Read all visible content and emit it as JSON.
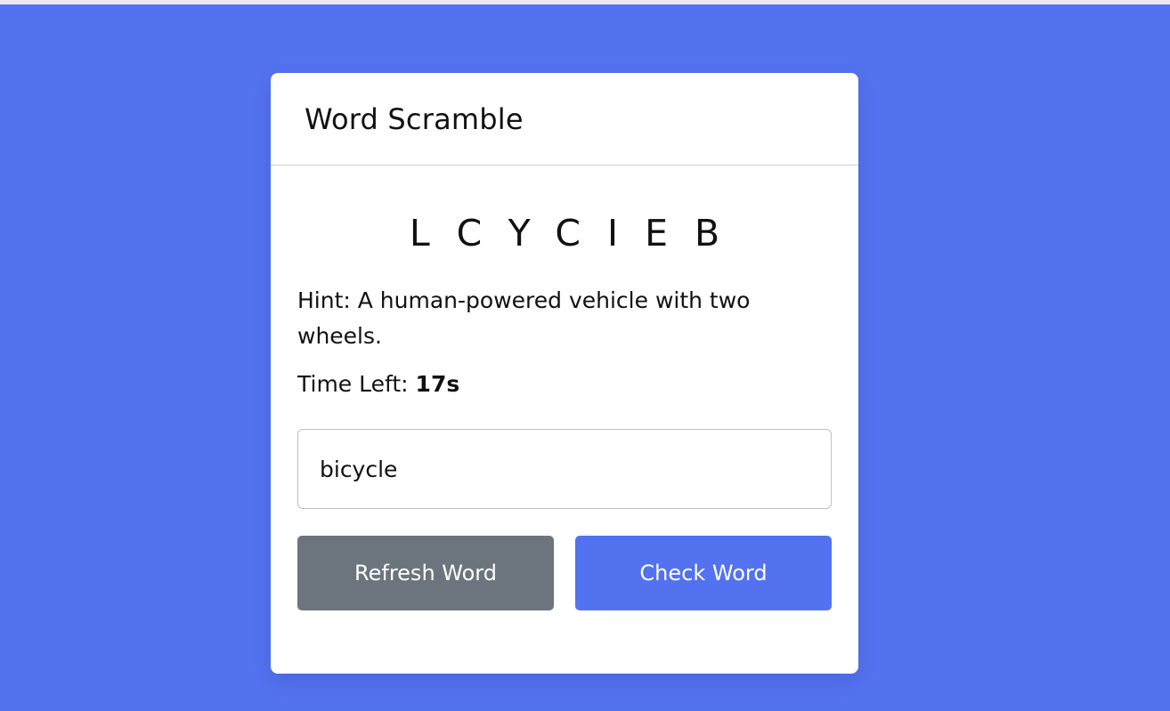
{
  "card": {
    "title": "Word Scramble",
    "scrambled_word": "LCYCIEB",
    "hint_text": "Hint: A human-powered vehicle with two wheels.",
    "time_label": "Time Left: ",
    "time_value": "17s",
    "input_value": "bicycle",
    "refresh_label": "Refresh Word",
    "check_label": "Check Word"
  },
  "colors": {
    "background": "#5372F0",
    "card": "#FFFFFF",
    "refresh_button": "#6C757D",
    "check_button": "#5372F0"
  }
}
